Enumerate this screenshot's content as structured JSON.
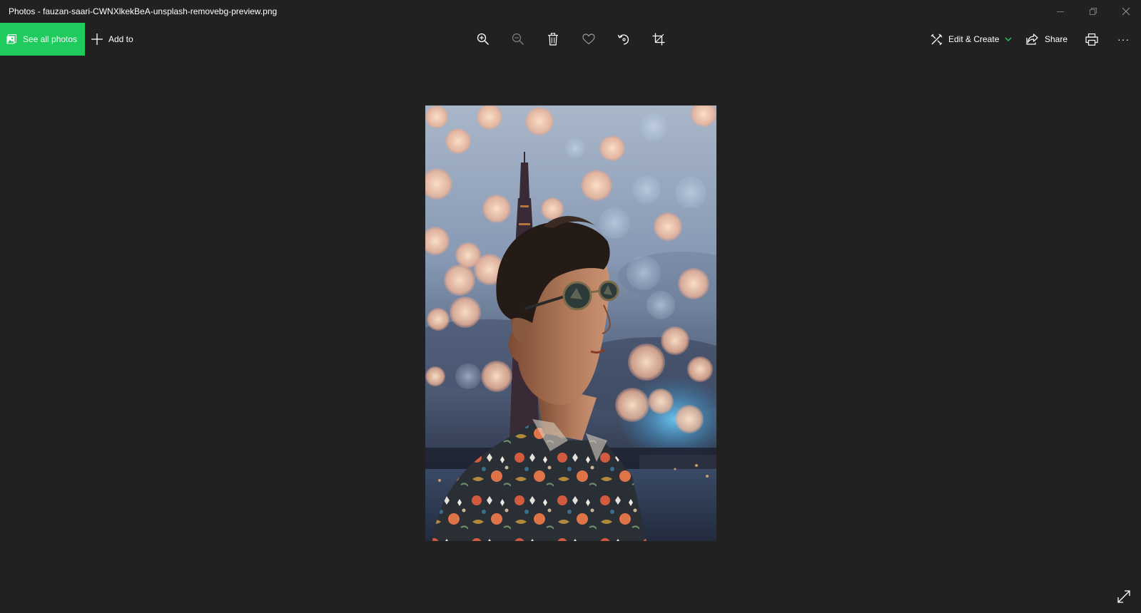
{
  "window": {
    "title": "Photos - fauzan-saari-CWNXlkekBeA-unsplash-removebg-preview.png"
  },
  "toolbar": {
    "see_all_label": "See all photos",
    "add_to_label": "Add to",
    "edit_create_label": "Edit & Create",
    "share_label": "Share",
    "more_label": "···"
  },
  "colors": {
    "background": "#212121",
    "accent": "#1fcb5c",
    "text": "#ffffff"
  },
  "icons": {
    "see_all": "photo-gallery-icon",
    "add_to": "plus-icon",
    "zoom_in": "zoom-in-icon",
    "zoom_out": "zoom-out-icon",
    "delete": "trash-icon",
    "favorite": "heart-icon",
    "rotate": "rotate-icon",
    "crop": "crop-icon",
    "edit_create": "edit-create-icon",
    "share": "share-icon",
    "print": "print-icon",
    "expand": "expand-icon"
  }
}
